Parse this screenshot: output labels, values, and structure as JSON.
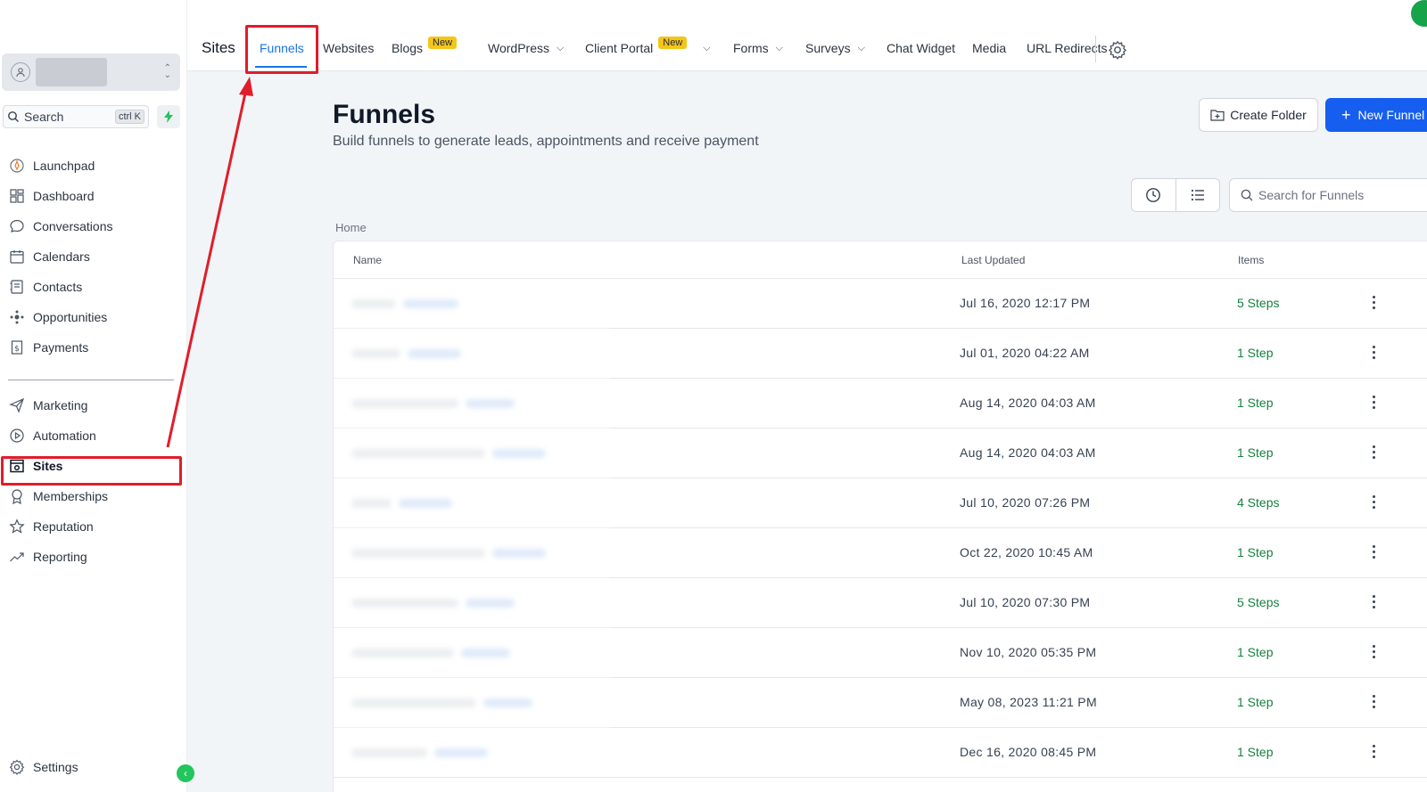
{
  "sidebar": {
    "search": {
      "label": "Search",
      "shortcut": "ctrl K"
    },
    "items": [
      {
        "label": "Launchpad",
        "icon": "rocket-icon"
      },
      {
        "label": "Dashboard",
        "icon": "grid-icon"
      },
      {
        "label": "Conversations",
        "icon": "chat-icon"
      },
      {
        "label": "Calendars",
        "icon": "calendar-icon"
      },
      {
        "label": "Contacts",
        "icon": "contacts-icon"
      },
      {
        "label": "Opportunities",
        "icon": "opportunities-icon"
      },
      {
        "label": "Payments",
        "icon": "payments-icon"
      }
    ],
    "items2": [
      {
        "label": "Marketing",
        "icon": "send-icon"
      },
      {
        "label": "Automation",
        "icon": "automation-icon"
      },
      {
        "label": "Sites",
        "icon": "sites-icon",
        "active": true
      },
      {
        "label": "Memberships",
        "icon": "badge-icon"
      },
      {
        "label": "Reputation",
        "icon": "star-icon"
      },
      {
        "label": "Reporting",
        "icon": "trend-icon"
      }
    ],
    "settings": {
      "label": "Settings"
    }
  },
  "topnav": {
    "title": "Sites",
    "tabs": [
      {
        "label": "Funnels",
        "active": true
      },
      {
        "label": "Websites"
      },
      {
        "label": "Blogs",
        "badge": "New"
      },
      {
        "label": "WordPress",
        "dropdown": true
      },
      {
        "label": "Client Portal",
        "badge": "New",
        "dropdown": true
      },
      {
        "label": "Forms",
        "dropdown": true
      },
      {
        "label": "Surveys",
        "dropdown": true
      },
      {
        "label": "Chat Widget"
      },
      {
        "label": "Media"
      },
      {
        "label": "URL Redirects"
      }
    ]
  },
  "page": {
    "title": "Funnels",
    "subtitle": "Build funnels to generate leads, appointments and receive payment",
    "create_folder": "Create Folder",
    "new_funnel": "New Funnel",
    "search_placeholder": "Search for Funnels",
    "breadcrumb": "Home"
  },
  "table": {
    "columns": [
      "Name",
      "Last Updated",
      "Items"
    ],
    "rows": [
      {
        "last_updated": "Jul 16, 2020 12:17 PM",
        "items": "5 Steps"
      },
      {
        "last_updated": "Jul 01, 2020 04:22 AM",
        "items": "1 Step"
      },
      {
        "last_updated": "Aug 14, 2020 04:03 AM",
        "items": "1 Step"
      },
      {
        "last_updated": "Aug 14, 2020 04:03 AM",
        "items": "1 Step"
      },
      {
        "last_updated": "Jul 10, 2020 07:26 PM",
        "items": "4 Steps"
      },
      {
        "last_updated": "Oct 22, 2020 10:45 AM",
        "items": "1 Step"
      },
      {
        "last_updated": "Jul 10, 2020 07:30 PM",
        "items": "5 Steps"
      },
      {
        "last_updated": "Nov 10, 2020 05:35 PM",
        "items": "1 Step"
      },
      {
        "last_updated": "May 08, 2023 11:21 PM",
        "items": "1 Step"
      },
      {
        "last_updated": "Dec 16, 2020 08:45 PM",
        "items": "1 Step"
      }
    ]
  },
  "colors": {
    "accent": "#155eef",
    "highlight": "#e11d2a",
    "steps": "#15803d"
  }
}
